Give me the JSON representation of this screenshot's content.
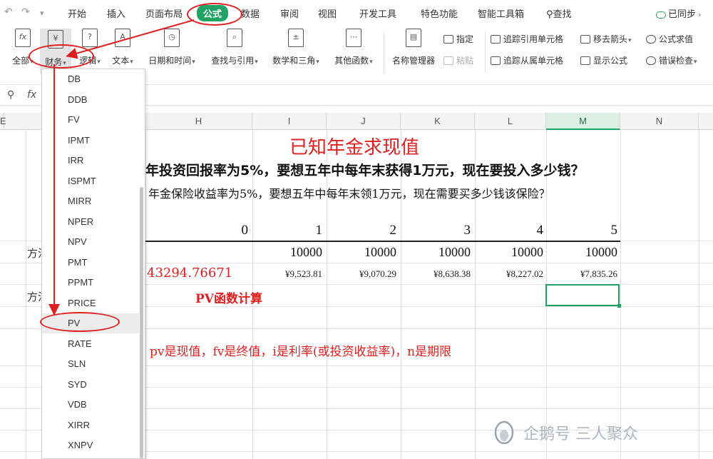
{
  "menubar": {
    "items": [
      "开始",
      "插入",
      "页面布局",
      "公式",
      "数据",
      "审阅",
      "视图",
      "开发工具",
      "特色功能",
      "智能工具箱"
    ],
    "active": "公式",
    "search": "查找",
    "sync": "已同步"
  },
  "ribbon": {
    "big_buttons": [
      {
        "label": "全部",
        "glyph": "fx"
      },
      {
        "label": "财务",
        "glyph": "¥"
      },
      {
        "label": "逻辑",
        "glyph": "?"
      },
      {
        "label": "文本",
        "glyph": "A"
      },
      {
        "label": "日期和时间",
        "glyph": "◷"
      },
      {
        "label": "查找与引用",
        "glyph": "⌕"
      },
      {
        "label": "数学和三角",
        "glyph": "±"
      },
      {
        "label": "其他函数",
        "glyph": "⋯"
      },
      {
        "label": "名称管理器",
        "glyph": "▤"
      }
    ],
    "small_buttons": {
      "specify": "指定",
      "paste": "粘贴",
      "trace_precedents": "追踪引用单元格",
      "trace_dependents": "追踪从属单元格",
      "remove_arrows": "移去箭头",
      "show_formulas": "显示公式",
      "eval_formula": "公式求值",
      "error_check": "错误检查"
    }
  },
  "formulabar": {
    "fx": "fx"
  },
  "columns": [
    "E",
    "H",
    "I",
    "J",
    "K",
    "L",
    "M",
    "N"
  ],
  "selected_column": "M",
  "sheet": {
    "title": "已知年金求现值",
    "question1": "年投资回报率为5%，要想五年中每年末获得1万元，现在要投入多少钱？",
    "question2": "年金保险收益率为5%，要想五年中每年末领1万元，现在需要买多少钱该保险？",
    "side_labels": [
      "方法",
      "方法"
    ],
    "periods": [
      "0",
      "1",
      "2",
      "3",
      "4",
      "5"
    ],
    "amounts": [
      "10000",
      "10000",
      "10000",
      "10000",
      "10000"
    ],
    "discounted": [
      "¥9,523.81",
      "¥9,070.29",
      "¥8,638.38",
      "¥8,227.02",
      "¥7,835.26"
    ],
    "total": "43294.76671",
    "pv_label": "PV函数计算",
    "note": "pv是现值，fv是终值，i是利率(或投资收益率)，n是期限"
  },
  "dropdown": {
    "items": [
      "DB",
      "DDB",
      "FV",
      "IPMT",
      "IRR",
      "ISPMT",
      "MIRR",
      "NPER",
      "NPV",
      "PMT",
      "PPMT",
      "PRICE",
      "PV",
      "RATE",
      "SLN",
      "SYD",
      "VDB",
      "XIRR",
      "XNPV"
    ],
    "highlighted": "PV"
  },
  "watermark": "企鹅号 三人聚众",
  "colors": {
    "accent": "#21a366",
    "annotation": "#e02020"
  }
}
